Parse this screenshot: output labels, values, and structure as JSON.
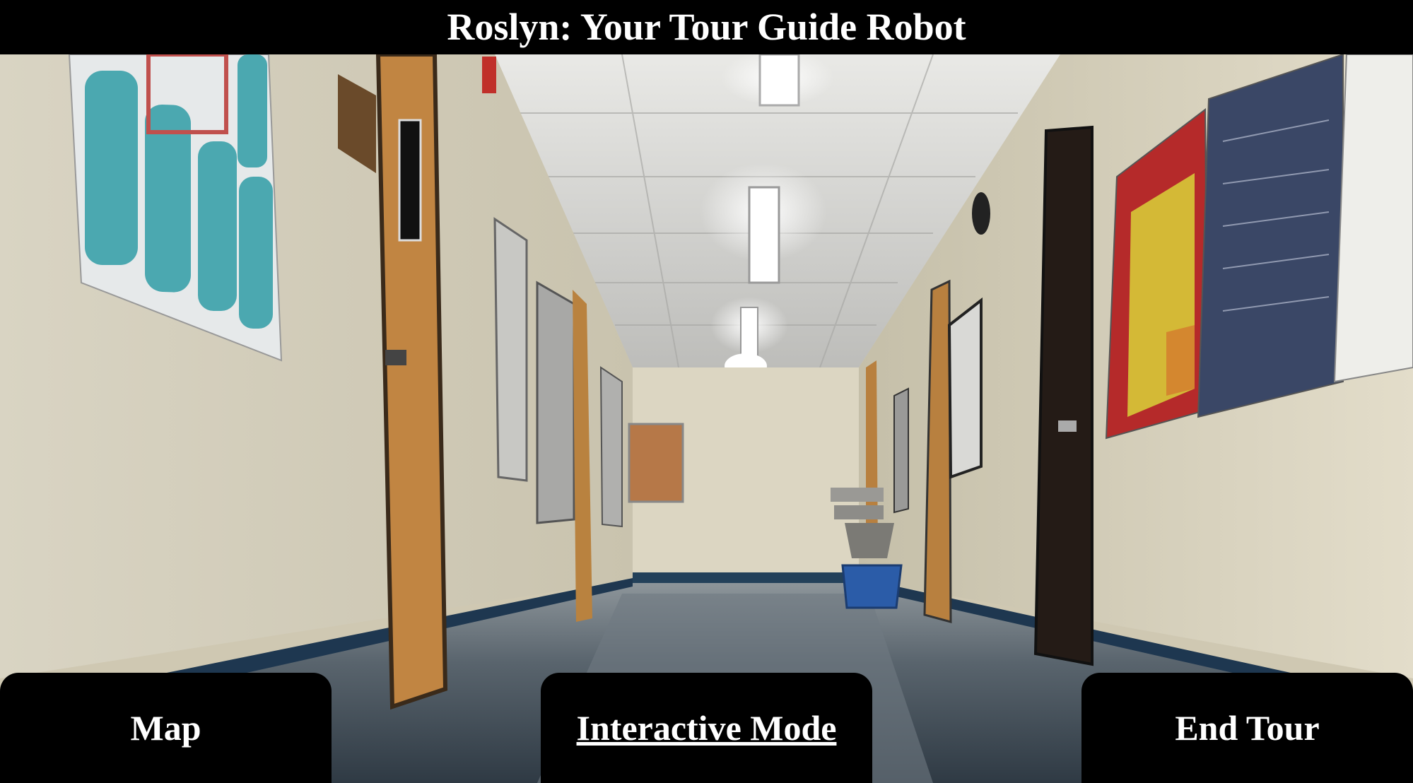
{
  "header": {
    "title": "Roslyn: Your Tour Guide Robot"
  },
  "camera": {
    "description_icon": "hallway-camera-feed"
  },
  "buttons": {
    "map": "Map",
    "interactive": "Interactive Mode",
    "end_tour": "End Tour"
  },
  "colors": {
    "background": "#000000",
    "text": "#ffffff",
    "wall": "#d6d0bb",
    "door": "#b98440",
    "floor": "#3e4b58"
  }
}
